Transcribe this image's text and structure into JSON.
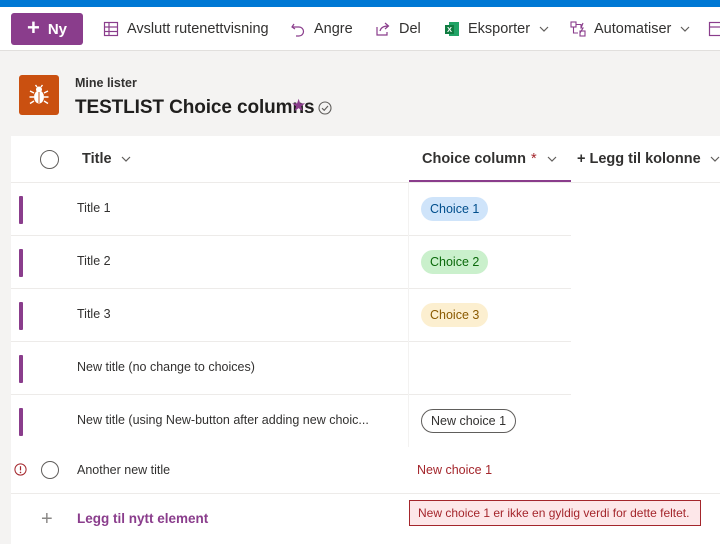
{
  "commandbar": {
    "new_label": "Ny",
    "exit_grid_label": "Avslutt rutenettvisning",
    "undo_label": "Angre",
    "share_label": "Del",
    "export_label": "Eksporter",
    "automate_label": "Automatiser"
  },
  "header": {
    "breadcrumb": "Mine lister",
    "title": "TESTLIST Choice columns"
  },
  "grid": {
    "columns": {
      "title": "Title",
      "choice": "Choice column",
      "required_marker": "*",
      "add_column": "+ Legg til kolonne"
    },
    "rows": [
      {
        "title": "Title 1",
        "choice": "Choice 1"
      },
      {
        "title": "Title 2",
        "choice": "Choice 2"
      },
      {
        "title": "Title 3",
        "choice": "Choice 3"
      },
      {
        "title": "New title (no change to choices)",
        "choice": ""
      },
      {
        "title": "New title (using New-button after adding new choic...",
        "choice": "New choice 1"
      }
    ],
    "error_row": {
      "title": "Another new title",
      "choice": "New choice 1"
    },
    "add_item_label": "Legg til nytt element",
    "error_message": "New choice 1 er ikke en gyldig verdi for dette feltet."
  },
  "colors": {
    "accent": "#8a3d8c",
    "topstrip": "#0078d4",
    "site_logo": "#ca5010",
    "choice1_bg": "#cfe4fa",
    "choice2_bg": "#caf0cc",
    "choice3_bg": "#fcefd0",
    "error": "#a4262c"
  },
  "icons": [
    "grid-icon",
    "undo-icon",
    "share-icon",
    "excel-icon",
    "automate-icon",
    "chevron-down-icon",
    "bug-icon",
    "star-icon",
    "verified-icon",
    "select-all-icon",
    "error-icon",
    "plus-icon"
  ]
}
